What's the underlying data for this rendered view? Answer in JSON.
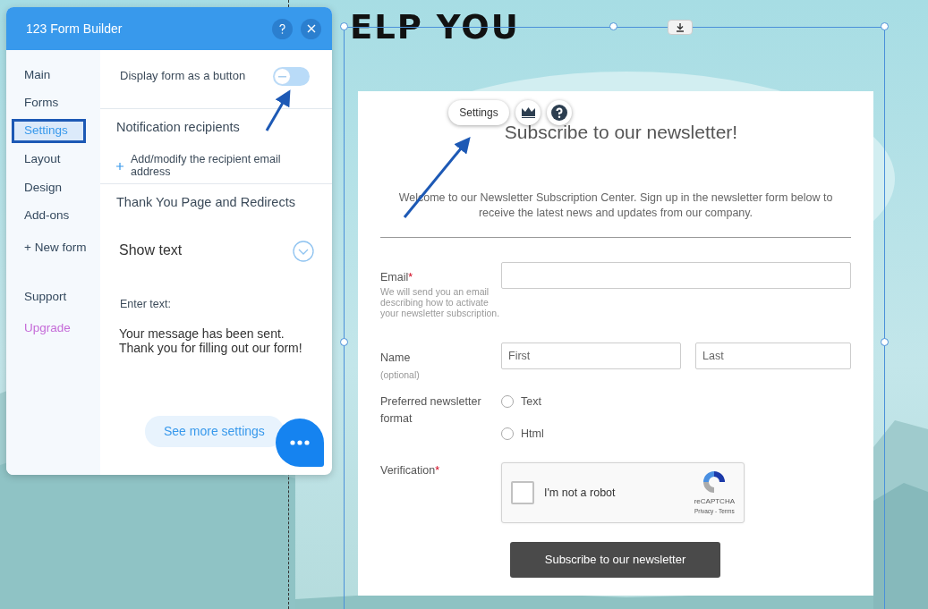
{
  "canvas": {
    "heading": "ELP YOU"
  },
  "panel": {
    "title": "123 Form Builder",
    "nav": [
      {
        "label": "Main",
        "selected": false
      },
      {
        "label": "Forms",
        "selected": false
      },
      {
        "label": "Settings",
        "selected": true
      },
      {
        "label": "Layout",
        "selected": false
      },
      {
        "label": "Design",
        "selected": false
      },
      {
        "label": "Add-ons",
        "selected": false
      },
      {
        "label": "+ New form",
        "selected": false
      }
    ],
    "nav_bottom": [
      {
        "label": "Support",
        "kind": "normal"
      },
      {
        "label": "Upgrade",
        "kind": "upgrade"
      }
    ],
    "display_as_button": {
      "label": "Display form as a button",
      "on": false
    },
    "notification": {
      "title": "Notification recipients",
      "link": "Add/modify the recipient email address"
    },
    "thank_you": {
      "title": "Thank You Page and Redirects"
    },
    "show_text": {
      "label": "Show text",
      "expanded": false
    },
    "enter_text": {
      "label": "Enter text:",
      "value": "Your message has been sent. Thank you for filling out our form!"
    },
    "more_button": "See more settings"
  },
  "form_toolbar": {
    "settings": "Settings"
  },
  "form": {
    "title": "Subscribe to our newsletter!",
    "required_mark": "*",
    "intro": "Welcome to our Newsletter Subscription Center. Sign up in the newsletter form below to receive the latest news and updates from our company.",
    "fields": [
      {
        "kind": "email",
        "label": "Email",
        "required": true,
        "hint": "We will send you an email describing how to activate your newsletter subscription."
      },
      {
        "kind": "name",
        "label": "Name",
        "required": false,
        "hint": "(optional)",
        "placeholders": [
          "First",
          "Last"
        ]
      },
      {
        "kind": "radio",
        "label": "Preferred newsletter format",
        "required": false,
        "options": [
          {
            "label": "Text",
            "selected": false
          },
          {
            "label": "Html",
            "selected": false
          }
        ]
      },
      {
        "kind": "captcha",
        "label": "Verification",
        "required": true,
        "checkbox": {
          "label": "I'm not a robot",
          "checked": false
        },
        "brand": "reCAPTCHA",
        "links": "Privacy - Terms"
      }
    ],
    "submit": "Subscribe to our newsletter"
  }
}
